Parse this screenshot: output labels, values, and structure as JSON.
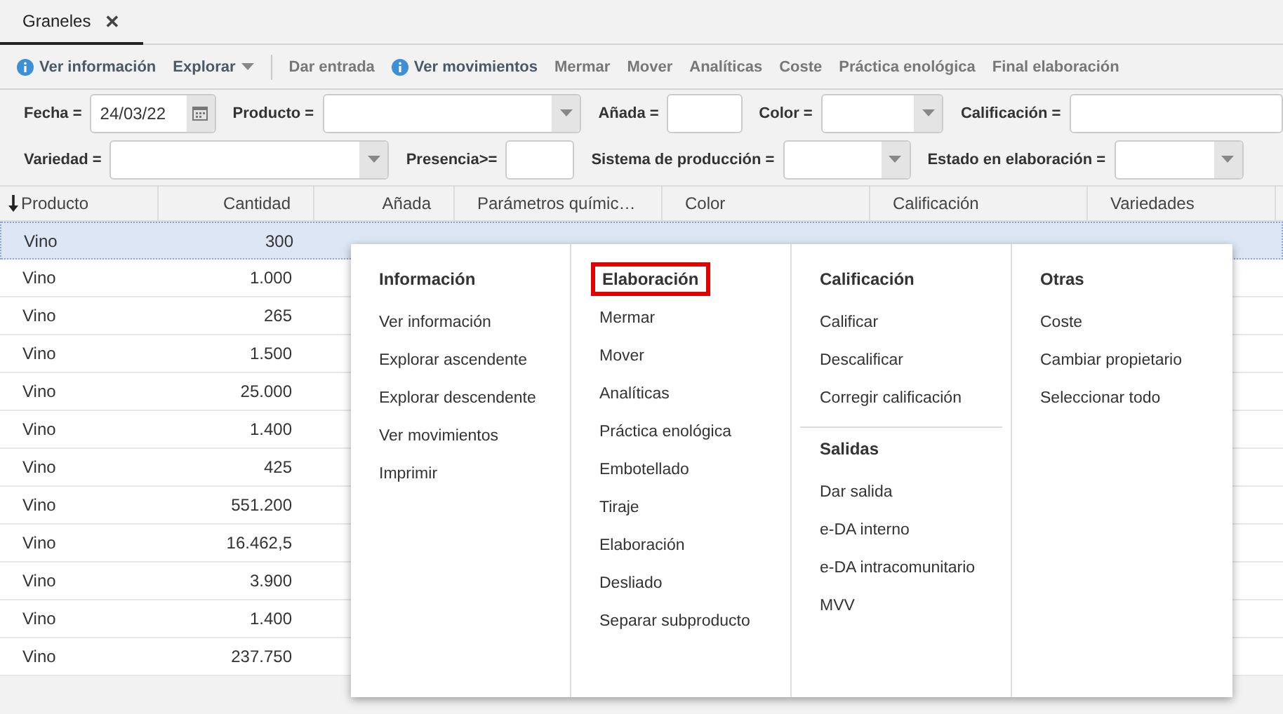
{
  "tabs": [
    {
      "label": "Graneles",
      "selected": true,
      "close": "✕"
    }
  ],
  "toolbar": {
    "groups": [
      [
        {
          "label": "Ver información",
          "kind": "info"
        },
        {
          "label": "Explorar",
          "kind": "dropdown"
        }
      ],
      [
        {
          "label": "Dar entrada",
          "kind": "plain"
        },
        {
          "label": "Ver movimientos",
          "kind": "info"
        },
        {
          "label": "Mermar",
          "kind": "plain"
        },
        {
          "label": "Mover",
          "kind": "plain"
        },
        {
          "label": "Analíticas",
          "kind": "plain"
        },
        {
          "label": "Coste",
          "kind": "plain"
        },
        {
          "label": "Práctica enológica",
          "kind": "plain"
        },
        {
          "label": "Final elaboración",
          "kind": "plain"
        }
      ]
    ]
  },
  "filters": [
    [
      {
        "label": "Fecha =",
        "kind": "date",
        "value": "24/03/22"
      },
      {
        "label": "Producto =",
        "kind": "select"
      },
      {
        "label": "Añada =",
        "kind": "text"
      },
      {
        "label": "Color =",
        "kind": "select"
      },
      {
        "label": "Calificación =",
        "kind": "text"
      }
    ],
    [
      {
        "label": "Variedad =",
        "kind": "select"
      },
      {
        "label": "Presencia>=",
        "kind": "text"
      },
      {
        "label": "Sistema de producción =",
        "kind": "select"
      },
      {
        "label": "Estado en elaboración =",
        "kind": "select"
      }
    ]
  ],
  "table": {
    "columns": [
      {
        "label": "Producto",
        "sorted": true
      },
      {
        "label": "Cantidad",
        "sorted": false
      },
      {
        "label": "Añada",
        "sorted": false
      },
      {
        "label": "Parámetros químic…",
        "sorted": false
      },
      {
        "label": "Color",
        "sorted": false
      },
      {
        "label": "Calificación",
        "sorted": false
      },
      {
        "label": "Variedades",
        "sorted": false
      }
    ],
    "rows": [
      {
        "producto": "Vino",
        "cantidad": "300",
        "selected": true
      },
      {
        "producto": "Vino",
        "cantidad": "1.000",
        "selected": false
      },
      {
        "producto": "Vino",
        "cantidad": "265",
        "selected": false
      },
      {
        "producto": "Vino",
        "cantidad": "1.500",
        "selected": false
      },
      {
        "producto": "Vino",
        "cantidad": "25.000",
        "selected": false
      },
      {
        "producto": "Vino",
        "cantidad": "1.400",
        "selected": false
      },
      {
        "producto": "Vino",
        "cantidad": "425",
        "selected": false
      },
      {
        "producto": "Vino",
        "cantidad": "551.200",
        "selected": false
      },
      {
        "producto": "Vino",
        "cantidad": "16.462,5",
        "selected": false
      },
      {
        "producto": "Vino",
        "cantidad": "3.900",
        "selected": false
      },
      {
        "producto": "Vino",
        "cantidad": "1.400",
        "selected": false
      },
      {
        "producto": "Vino",
        "cantidad": "237.750",
        "selected": false
      }
    ]
  },
  "context_menu": {
    "columns": [
      {
        "sections": [
          {
            "title": "Información",
            "highlighted": false,
            "items": [
              "Ver información",
              "Explorar ascendente",
              "Explorar descendente",
              "Ver movimientos",
              "Imprimir"
            ]
          }
        ]
      },
      {
        "sections": [
          {
            "title": "Elaboración",
            "highlighted": true,
            "items": [
              "Mermar",
              "Mover",
              "Analíticas",
              "Práctica enológica",
              "Embotellado",
              "Tiraje",
              "Elaboración",
              "Desliado",
              "Separar subproducto"
            ]
          }
        ]
      },
      {
        "sections": [
          {
            "title": "Calificación",
            "highlighted": false,
            "items": [
              "Calificar",
              "Descalificar",
              "Corregir calificación"
            ]
          },
          {
            "title": "Salidas",
            "highlighted": false,
            "items": [
              "Dar salida",
              "e-DA interno",
              "e-DA intracomunitario",
              "MVV"
            ]
          }
        ]
      },
      {
        "sections": [
          {
            "title": "Otras",
            "highlighted": false,
            "items": [
              "Coste",
              "Cambiar propietario",
              "Seleccionar todo"
            ]
          }
        ]
      }
    ]
  }
}
